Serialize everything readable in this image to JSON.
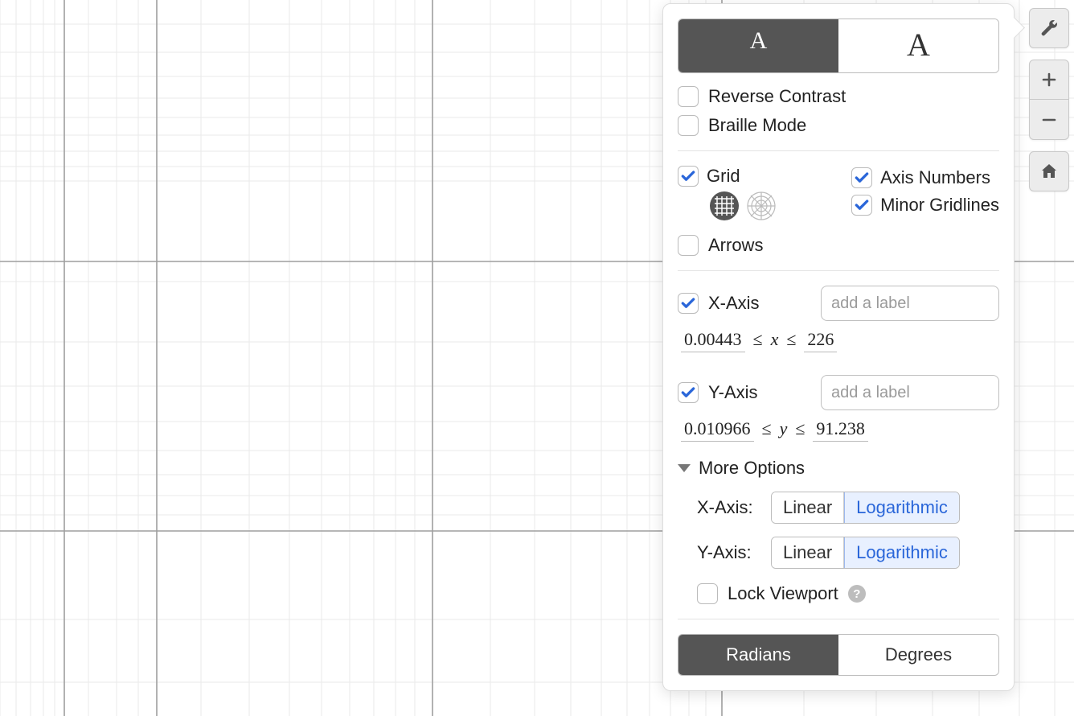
{
  "contrast": {
    "normal": "A",
    "large": "A",
    "active": "normal"
  },
  "options": {
    "reverseContrast": {
      "label": "Reverse Contrast",
      "checked": false
    },
    "brailleMode": {
      "label": "Braille Mode",
      "checked": false
    },
    "grid": {
      "label": "Grid",
      "checked": true
    },
    "axisNumbers": {
      "label": "Axis Numbers",
      "checked": true
    },
    "minorGridlines": {
      "label": "Minor Gridlines",
      "checked": true
    },
    "arrows": {
      "label": "Arrows",
      "checked": false
    },
    "lockViewport": {
      "label": "Lock Viewport",
      "checked": false
    }
  },
  "xAxis": {
    "label": "X-Axis",
    "checked": true,
    "placeholder": "add a label",
    "min": "0.00443",
    "max": "226",
    "var": "x"
  },
  "yAxis": {
    "label": "Y-Axis",
    "checked": true,
    "placeholder": "add a label",
    "min": "0.010966",
    "max": "91.238",
    "var": "y"
  },
  "more": {
    "label": "More Options"
  },
  "scale": {
    "xLabel": "X-Axis:",
    "yLabel": "Y-Axis:",
    "linear": "Linear",
    "logarithmic": "Logarithmic",
    "xSelected": "log",
    "ySelected": "log"
  },
  "angle": {
    "radians": "Radians",
    "degrees": "Degrees",
    "active": "radians"
  },
  "rangeOp": "≤"
}
